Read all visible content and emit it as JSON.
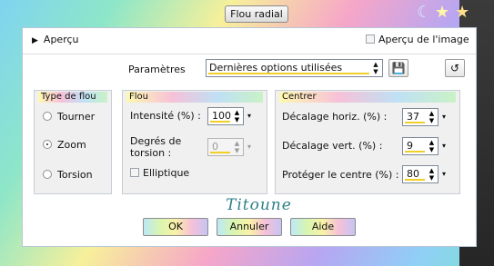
{
  "window": {
    "title": "Flou radial"
  },
  "header": {
    "preview_label": "Aperçu",
    "image_preview_label": "Aperçu de l'image"
  },
  "params": {
    "label": "Paramètres",
    "preset_value": "Dernières options utilisées"
  },
  "blur_type": {
    "title": "Type de flou",
    "options": [
      "Tourner",
      "Zoom",
      "Torsion"
    ],
    "selected": "Zoom"
  },
  "blur": {
    "title": "Flou",
    "intensity_label": "Intensité (%) :",
    "intensity_value": "100",
    "torsion_label_line1": "Degrés de",
    "torsion_label_line2": "torsion :",
    "torsion_value": "0",
    "elliptic_label": "Elliptique"
  },
  "center": {
    "title": "Centrer",
    "h_offset_label": "Décalage horiz. (%) :",
    "h_offset_value": "37",
    "v_offset_label": "Décalage vert. (%) :",
    "v_offset_value": "9",
    "protect_label": "Protéger le centre (%) :",
    "protect_value": "80"
  },
  "buttons": {
    "ok": "OK",
    "cancel": "Annuler",
    "help": "Aide"
  },
  "watermark": "Titoune",
  "icons": {
    "moon": "moon-icon",
    "star": "star-icon",
    "save": "save-icon",
    "reset": "reset-icon"
  }
}
